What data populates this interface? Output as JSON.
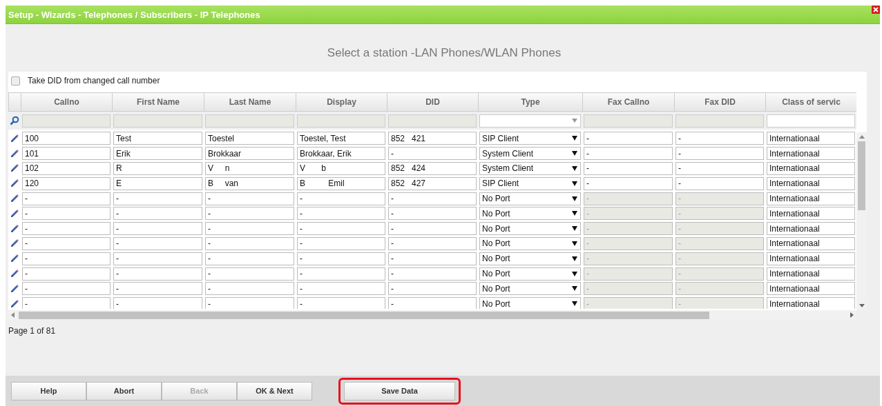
{
  "window": {
    "title": "Setup - Wizards - Telephones / Subscribers - IP Telephones"
  },
  "heading": "Select a station -LAN Phones/WLAN Phones",
  "take_did": {
    "label": "Take DID from changed call number",
    "checked": false
  },
  "table": {
    "columns": [
      "Callno",
      "First Name",
      "Last Name",
      "Display",
      "DID",
      "Type",
      "Fax Callno",
      "Fax DID",
      "Class of servic"
    ],
    "rows": [
      {
        "callno": "100",
        "first_name": "Test",
        "last_name": "Toestel",
        "display": "Toestel, Test",
        "did": "852   421",
        "type": "SIP Client",
        "fax_callno": "-",
        "fax_did": "-",
        "class_of_service": "Internationaal",
        "fax_disabled": false
      },
      {
        "callno": "101",
        "first_name": "Erik",
        "last_name": "Brokkaar",
        "display": "Brokkaar, Erik",
        "did": "-",
        "type": "System Client",
        "fax_callno": "-",
        "fax_did": "-",
        "class_of_service": "Internationaal",
        "fax_disabled": false
      },
      {
        "callno": "102",
        "first_name": "R",
        "last_name": "V     n",
        "display": "V       b",
        "did": "852   424",
        "type": "System Client",
        "fax_callno": "-",
        "fax_did": "-",
        "class_of_service": "Internationaal",
        "fax_disabled": false
      },
      {
        "callno": "120",
        "first_name": "E",
        "last_name": "B     van",
        "display": "B          Emil",
        "did": "852   427",
        "type": "SIP Client",
        "fax_callno": "-",
        "fax_did": "-",
        "class_of_service": "Internationaal",
        "fax_disabled": false
      },
      {
        "callno": "-",
        "first_name": "-",
        "last_name": "-",
        "display": "-",
        "did": "-",
        "type": "No Port",
        "fax_callno": "-",
        "fax_did": "-",
        "class_of_service": "Internationaal",
        "fax_disabled": true
      },
      {
        "callno": "-",
        "first_name": "-",
        "last_name": "-",
        "display": "-",
        "did": "-",
        "type": "No Port",
        "fax_callno": "-",
        "fax_did": "-",
        "class_of_service": "Internationaal",
        "fax_disabled": true
      },
      {
        "callno": "-",
        "first_name": "-",
        "last_name": "-",
        "display": "-",
        "did": "-",
        "type": "No Port",
        "fax_callno": "-",
        "fax_did": "-",
        "class_of_service": "Internationaal",
        "fax_disabled": true
      },
      {
        "callno": "-",
        "first_name": "-",
        "last_name": "-",
        "display": "-",
        "did": "-",
        "type": "No Port",
        "fax_callno": "-",
        "fax_did": "-",
        "class_of_service": "Internationaal",
        "fax_disabled": true
      },
      {
        "callno": "-",
        "first_name": "-",
        "last_name": "-",
        "display": "-",
        "did": "-",
        "type": "No Port",
        "fax_callno": "-",
        "fax_did": "-",
        "class_of_service": "Internationaal",
        "fax_disabled": true
      },
      {
        "callno": "-",
        "first_name": "-",
        "last_name": "-",
        "display": "-",
        "did": "-",
        "type": "No Port",
        "fax_callno": "-",
        "fax_did": "-",
        "class_of_service": "Internationaal",
        "fax_disabled": true
      },
      {
        "callno": "-",
        "first_name": "-",
        "last_name": "-",
        "display": "-",
        "did": "-",
        "type": "No Port",
        "fax_callno": "-",
        "fax_did": "-",
        "class_of_service": "Internationaal",
        "fax_disabled": true
      },
      {
        "callno": "-",
        "first_name": "-",
        "last_name": "-",
        "display": "-",
        "did": "-",
        "type": "No Port",
        "fax_callno": "-",
        "fax_did": "-",
        "class_of_service": "Internationaal",
        "fax_disabled": true
      }
    ]
  },
  "pager": "Page 1 of 81",
  "buttons": [
    {
      "label": "Help",
      "disabled": false,
      "highlighted": false
    },
    {
      "label": "Abort",
      "disabled": false,
      "highlighted": false
    },
    {
      "label": "Back",
      "disabled": true,
      "highlighted": false
    },
    {
      "label": "OK & Next",
      "disabled": false,
      "highlighted": false
    },
    {
      "label": "Save Data",
      "disabled": false,
      "highlighted": true
    }
  ]
}
